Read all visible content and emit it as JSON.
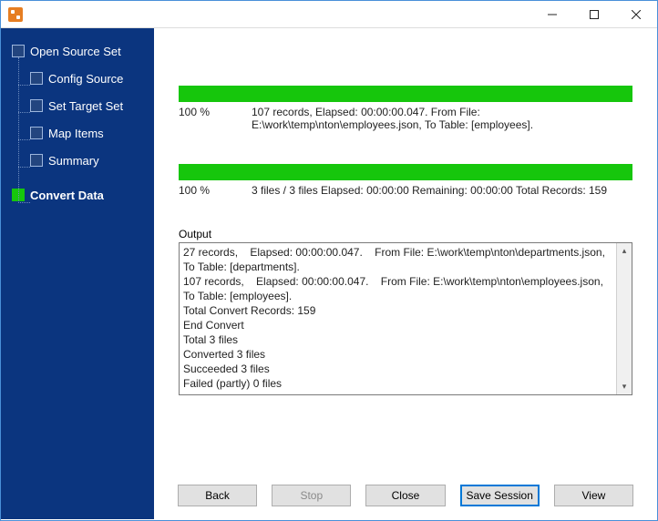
{
  "sidebar": {
    "items": [
      {
        "label": "Open Source Set"
      },
      {
        "label": "Config Source"
      },
      {
        "label": "Set Target Set"
      },
      {
        "label": "Map Items"
      },
      {
        "label": "Summary"
      },
      {
        "label": "Convert Data"
      }
    ]
  },
  "progress": {
    "file": {
      "percent": "100 %",
      "details": "107 records,    Elapsed: 00:00:00.047.    From File: E:\\work\\temp\\nton\\employees.json,    To Table: [employees]."
    },
    "overall": {
      "percent": "100 %",
      "details": "3 files / 3 files    Elapsed: 00:00:00    Remaining: 00:00:00    Total Records: 159"
    }
  },
  "output": {
    "label": "Output",
    "text": "27 records,    Elapsed: 00:00:00.047.    From File: E:\\work\\temp\\nton\\departments.json,    To Table: [departments].\n107 records,    Elapsed: 00:00:00.047.    From File: E:\\work\\temp\\nton\\employees.json,    To Table: [employees].\nTotal Convert Records: 159\nEnd Convert\nTotal 3 files\nConverted 3 files\nSucceeded 3 files\nFailed (partly) 0 files"
  },
  "buttons": {
    "back": "Back",
    "stop": "Stop",
    "close": "Close",
    "save_session": "Save Session",
    "view": "View"
  }
}
